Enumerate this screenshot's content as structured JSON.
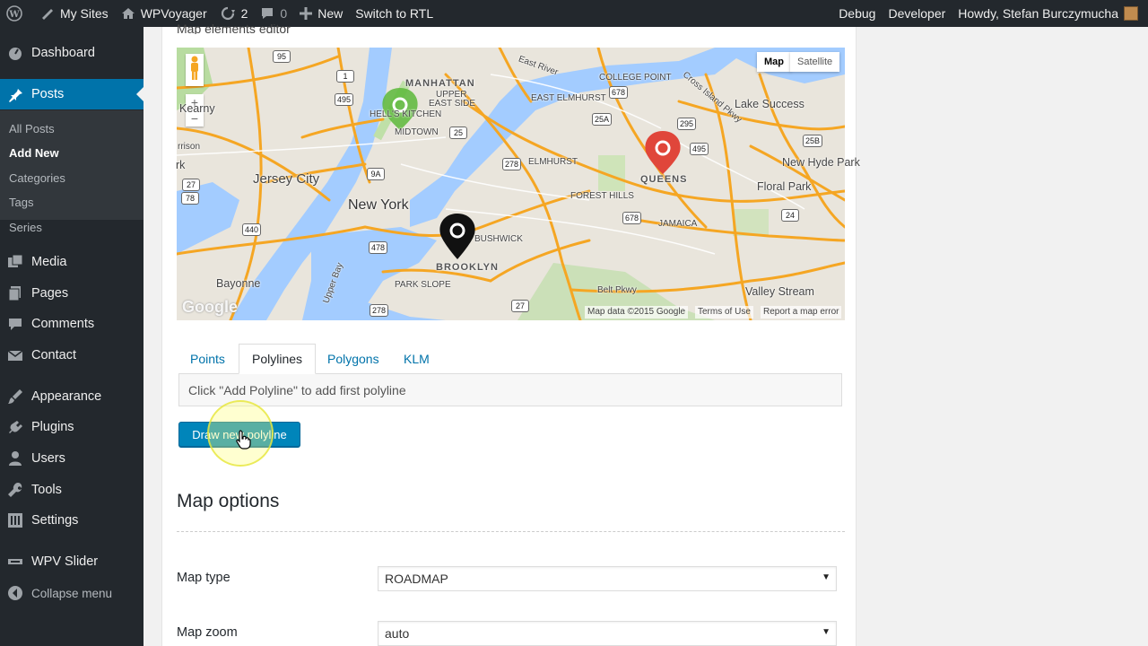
{
  "adminbar": {
    "my_sites": "My Sites",
    "site_name": "WPVoyager",
    "updates_count": "2",
    "comments_count": "0",
    "new_label": "New",
    "rtl_label": "Switch to RTL",
    "debug_label": "Debug",
    "developer_label": "Developer",
    "howdy": "Howdy, Stefan Burczymucha"
  },
  "sidebar": {
    "dashboard": "Dashboard",
    "posts": "Posts",
    "submenu": [
      "All Posts",
      "Add New",
      "Categories",
      "Tags",
      "Series"
    ],
    "media": "Media",
    "pages": "Pages",
    "comments": "Comments",
    "contact": "Contact",
    "appearance": "Appearance",
    "plugins": "Plugins",
    "users": "Users",
    "tools": "Tools",
    "settings": "Settings",
    "wpv_slider": "WPV Slider",
    "collapse": "Collapse menu"
  },
  "panel": {
    "title": "Map elements editor"
  },
  "map": {
    "type_buttons": [
      "Map",
      "Satellite"
    ],
    "labels": {
      "manhattan": "MANHATTAN",
      "upper_east": "UPPER",
      "upper_east2": "EAST SIDE",
      "hells": "HELL'S KITCHEN",
      "midtown": "MIDTOWN",
      "jersey_city": "Jersey City",
      "new_york": "New York",
      "brooklyn": "BROOKLYN",
      "bushwick": "BUSHWICK",
      "queens": "QUEENS",
      "elmhurst": "ELMHURST",
      "forest_hills": "FOREST HILLS",
      "jamaica": "JAMAICA",
      "east_elmhurst": "EAST ELMHURST",
      "college_point": "COLLEGE POINT",
      "lake_success": "Lake Success",
      "new_hyde_park": "New Hyde Park",
      "floral_park": "Floral Park",
      "bayonne": "Bayonne",
      "valley_stream": "Valley Stream",
      "park_slope": "PARK SLOPE",
      "upper_bay": "Upper Bay",
      "east_river": "East River",
      "belt_pkwy": "Belt Pkwy",
      "kearny": "Kearny",
      "rk": "rk",
      "harrison": "rrison",
      "cross_island": "Cross Island Pkwy"
    },
    "shields": [
      "95",
      "1",
      "495",
      "25",
      "278",
      "9A",
      "478",
      "440",
      "278",
      "27",
      "678",
      "25A",
      "295",
      "495",
      "25B",
      "24",
      "678",
      "27",
      "78"
    ],
    "google": "Google",
    "attribution": [
      "Map data ©2015 Google",
      "Terms of Use",
      "Report a map error"
    ],
    "zoom_in": "+",
    "zoom_out": "−"
  },
  "tabs": [
    "Points",
    "Polylines",
    "Polygons",
    "KLM"
  ],
  "tab_content": "Click \"Add Polyline\" to add first polyline",
  "draw_button": "Draw new polyline",
  "map_options": {
    "heading": "Map options",
    "map_type_label": "Map type",
    "map_type_value": "ROADMAP",
    "map_zoom_label": "Map zoom",
    "map_zoom_value": "auto"
  },
  "colors": {
    "adminbar": "#23282d",
    "accent": "#0073aa",
    "button": "#0085ba",
    "pin_green": "#5cb83a",
    "pin_red": "#e0463a",
    "pin_black": "#111111"
  }
}
